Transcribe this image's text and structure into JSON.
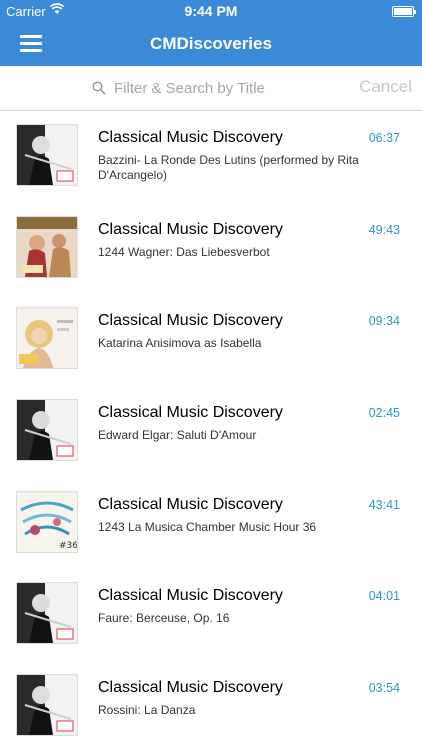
{
  "status": {
    "carrier": "Carrier",
    "time": "9:44 PM"
  },
  "nav": {
    "title": "CMDiscoveries"
  },
  "search": {
    "placeholder": "Filter & Search by Title",
    "cancel_label": "Cancel"
  },
  "episodes": [
    {
      "title": "Classical Music Discovery",
      "subtitle": "Bazzini- La Ronde Des Lutins (performed by Rita D'Arcangelo)",
      "duration": "06:37",
      "thumb": "flute"
    },
    {
      "title": "Classical Music Discovery",
      "subtitle": "1244 Wagner: Das Liebesverbot",
      "duration": "49:43",
      "thumb": "opera"
    },
    {
      "title": "Classical Music Discovery",
      "subtitle": "Katarina Anisimova as Isabella",
      "duration": "09:34",
      "thumb": "portrait"
    },
    {
      "title": "Classical Music Discovery",
      "subtitle": "Edward Elgar: Saluti D'Amour",
      "duration": "02:45",
      "thumb": "flute"
    },
    {
      "title": "Classical Music Discovery",
      "subtitle": "1243 La Musica Chamber Music Hour 36",
      "duration": "43:41",
      "thumb": "notes"
    },
    {
      "title": "Classical Music Discovery",
      "subtitle": "Faure: Berceuse, Op. 16",
      "duration": "04:01",
      "thumb": "flute"
    },
    {
      "title": "Classical Music Discovery",
      "subtitle": "Rossini: La Danza",
      "duration": "03:54",
      "thumb": "flute"
    }
  ]
}
